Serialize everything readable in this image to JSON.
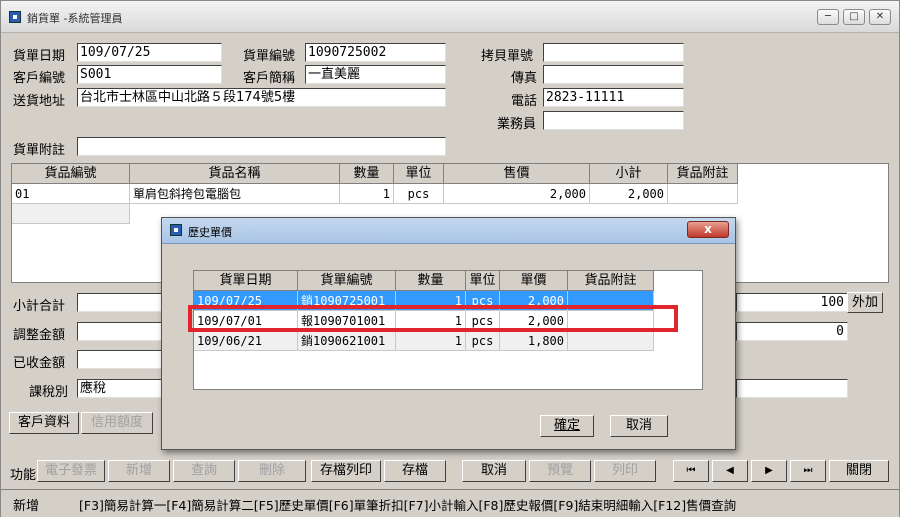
{
  "window": {
    "title": "銷貨單 -系統管理員",
    "controls": [
      "─",
      "□",
      "✕"
    ]
  },
  "header": {
    "date_label": "貨單日期",
    "date_value": "109/07/25",
    "order_no_label": "貨單編號",
    "order_no_value": "1090725002",
    "copy_label": "拷貝單號",
    "copy_value": "",
    "customer_no_label": "客戶編號",
    "customer_no_value": "S001",
    "customer_name_label": "客戶簡稱",
    "customer_name_value": "一直美麗",
    "fax_label": "傳真",
    "fax_value": "",
    "address_label": "送貨地址",
    "address_value": "台北市士林區中山北路５段174號5樓",
    "phone_label": "電話",
    "phone_value": "2823-11111",
    "sales_label": "業務員",
    "sales_value": "",
    "note_label": "貨單附註",
    "note_value": ""
  },
  "items_grid": {
    "headers": [
      "貨品編號",
      "貨品名稱",
      "數量",
      "單位",
      "售價",
      "小計",
      "貨品附註"
    ],
    "rows": [
      {
        "code": "01",
        "name": "單肩包斜挎包電腦包",
        "qty": "1",
        "unit": "pcs",
        "price": "2,000",
        "subtotal": "2,000",
        "note": ""
      }
    ]
  },
  "totals": {
    "subtotal_label": "小計合計",
    "subtotal_value": "100",
    "adjust_label": "調整金額",
    "adjust_value": "0",
    "received_label": "已收金額",
    "received_value": "",
    "tax_label": "課稅別",
    "tax_value": "應稅",
    "extra_btn": "外加"
  },
  "tabs": {
    "customer": "客戶資料",
    "credit": "信用額度"
  },
  "dialog": {
    "title": "歷史單價",
    "headers": [
      "貨單日期",
      "貨單編號",
      "數量",
      "單位",
      "單價",
      "貨品附註"
    ],
    "rows": [
      {
        "date": "109/07/25",
        "no": "銷1090725001",
        "qty": "1",
        "unit": "pcs",
        "price": "2,000",
        "note": ""
      },
      {
        "date": "109/07/01",
        "no": "報1090701001",
        "qty": "1",
        "unit": "pcs",
        "price": "2,000",
        "note": ""
      },
      {
        "date": "109/06/21",
        "no": "銷1090621001",
        "qty": "1",
        "unit": "pcs",
        "price": "1,800",
        "note": ""
      }
    ],
    "ok": "確定",
    "cancel": "取消",
    "close": "x"
  },
  "toolbar": {
    "func_label": "功能",
    "einvoice": "電子發票",
    "add": "新增",
    "query": "查詢",
    "delete": "刪除",
    "save_print": "存檔列印",
    "save": "存檔",
    "cancel": "取消",
    "preview": "預覽",
    "print": "列印",
    "first": "⏮",
    "prev": "◀",
    "next": "▶",
    "last": "⏭",
    "close": "關閉"
  },
  "status": {
    "mode": "新增",
    "hints": "[F3]簡易計算一[F4]簡易計算二[F5]歷史單價[F6]單筆折扣[F7]小計輸入[F8]歷史報價[F9]結束明細輸入[F12]售價查詢"
  },
  "colors": {
    "selection": "#3399ff",
    "highlight_box": "#e0262c",
    "window_bg": "#d4d0c8"
  }
}
